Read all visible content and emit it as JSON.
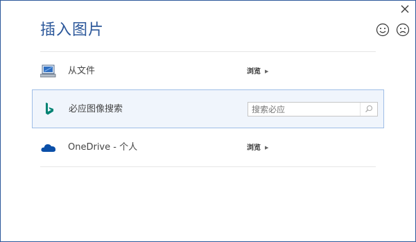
{
  "dialog": {
    "title": "插入图片",
    "accent_color": "#2b579a"
  },
  "feedback": {
    "smile_icon": "smile-icon",
    "frown_icon": "frown-icon"
  },
  "rows": [
    {
      "icon": "computer-icon",
      "label": "从文件",
      "browse_label": "浏览"
    },
    {
      "icon": "bing-icon",
      "label": "必应图像搜索",
      "search_placeholder": "搜索必应",
      "search_value": ""
    },
    {
      "icon": "onedrive-icon",
      "label": "OneDrive - 个人",
      "browse_label": "浏览"
    }
  ]
}
